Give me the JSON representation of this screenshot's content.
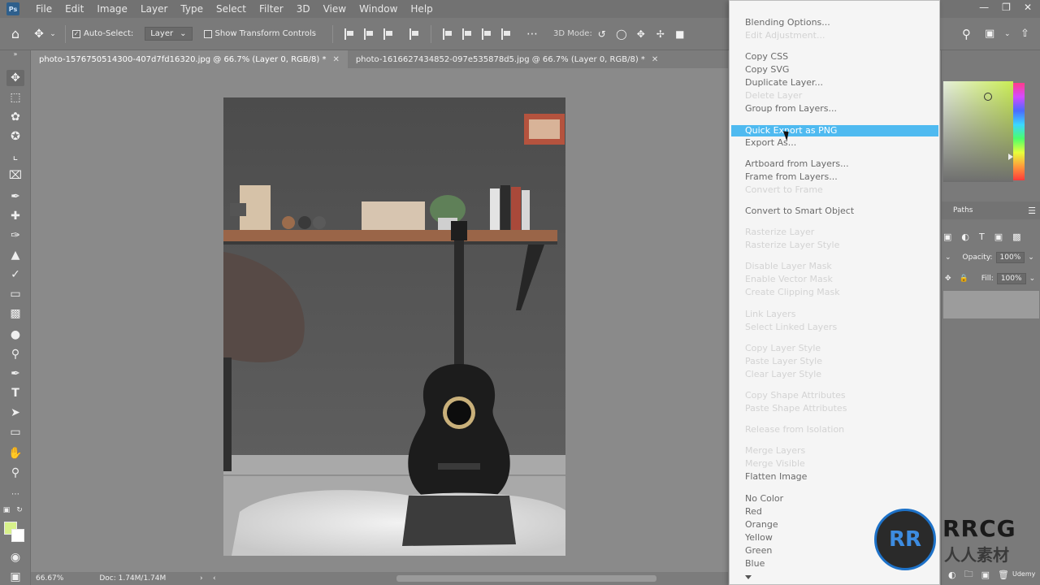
{
  "menubar": {
    "logo": "Ps",
    "items": [
      "File",
      "Edit",
      "Image",
      "Layer",
      "Type",
      "Select",
      "Filter",
      "3D",
      "View",
      "Window",
      "Help"
    ]
  },
  "options": {
    "auto_select_label": "Auto-Select:",
    "auto_select_checked": true,
    "layer_select": "Layer",
    "show_transform_label": "Show Transform Controls",
    "mode_3d": "3D Mode:"
  },
  "tabs": [
    {
      "label": "photo-1576750514300-407d7fd16320.jpg @ 66.7% (Layer 0, RGB/8) *",
      "active": true
    },
    {
      "label": "photo-1616627434852-097e535878d5.jpg @ 66.7% (Layer 0, RGB/8) *",
      "active": false
    }
  ],
  "status": {
    "zoom": "66.67%",
    "doc": "Doc: 1.74M/1.74M"
  },
  "panel": {
    "paths_tab": "Paths",
    "opacity_label": "Opacity:",
    "opacity_value": "100%",
    "fill_label": "Fill:",
    "fill_value": "100%"
  },
  "context_menu": {
    "highlighted": "Quick Export as PNG",
    "items": [
      {
        "label": "Blending Options...",
        "enabled": true
      },
      {
        "label": "Edit Adjustment...",
        "enabled": false
      },
      {
        "label": "Copy CSS",
        "enabled": true
      },
      {
        "label": "Copy SVG",
        "enabled": true
      },
      {
        "label": "Duplicate Layer...",
        "enabled": true
      },
      {
        "label": "Delete Layer",
        "enabled": false
      },
      {
        "label": "Group from Layers...",
        "enabled": true
      },
      {
        "label": "Quick Export as PNG",
        "enabled": true
      },
      {
        "label": "Export As...",
        "enabled": true
      },
      {
        "label": "Artboard from Layers...",
        "enabled": true
      },
      {
        "label": "Frame from Layers...",
        "enabled": true
      },
      {
        "label": "Convert to Frame",
        "enabled": false
      },
      {
        "label": "Convert to Smart Object",
        "enabled": true
      },
      {
        "label": "Rasterize Layer",
        "enabled": false
      },
      {
        "label": "Rasterize Layer Style",
        "enabled": false
      },
      {
        "label": "Disable Layer Mask",
        "enabled": false
      },
      {
        "label": "Enable Vector Mask",
        "enabled": false
      },
      {
        "label": "Create Clipping Mask",
        "enabled": false
      },
      {
        "label": "Link Layers",
        "enabled": false
      },
      {
        "label": "Select Linked Layers",
        "enabled": false
      },
      {
        "label": "Copy Layer Style",
        "enabled": false
      },
      {
        "label": "Paste Layer Style",
        "enabled": false
      },
      {
        "label": "Clear Layer Style",
        "enabled": false
      },
      {
        "label": "Copy Shape Attributes",
        "enabled": false
      },
      {
        "label": "Paste Shape Attributes",
        "enabled": false
      },
      {
        "label": "Release from Isolation",
        "enabled": false
      },
      {
        "label": "Merge Layers",
        "enabled": false
      },
      {
        "label": "Merge Visible",
        "enabled": false
      },
      {
        "label": "Flatten Image",
        "enabled": true
      },
      {
        "label": "No Color",
        "enabled": true
      },
      {
        "label": "Red",
        "enabled": true
      },
      {
        "label": "Orange",
        "enabled": true
      },
      {
        "label": "Yellow",
        "enabled": true
      },
      {
        "label": "Green",
        "enabled": true
      },
      {
        "label": "Blue",
        "enabled": true
      }
    ]
  },
  "watermark": {
    "logo_text": "RR",
    "brand": "RRCG",
    "brand_cn": "人人素材",
    "udemy": "Udemy"
  },
  "colors": {
    "foreground": "#d7f18a",
    "background": "#ffffff",
    "menu_highlight": "#4fbaf0"
  }
}
